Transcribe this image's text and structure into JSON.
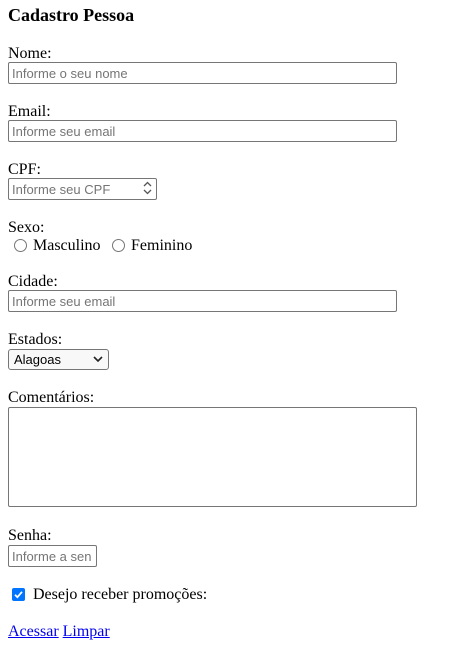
{
  "title": "Cadastro Pessoa",
  "fields": {
    "nome": {
      "label": "Nome:",
      "placeholder": "Informe o seu nome"
    },
    "email": {
      "label": "Email:",
      "placeholder": "Informe seu email"
    },
    "cpf": {
      "label": "CPF:",
      "placeholder": "Informe seu CPF"
    },
    "sexo": {
      "label": "Sexo:",
      "options": [
        "Masculino",
        "Feminino"
      ]
    },
    "cidade": {
      "label": "Cidade:",
      "placeholder": "Informe seu email"
    },
    "estados": {
      "label": "Estados:",
      "selected": "Alagoas"
    },
    "comentarios": {
      "label": "Comentários:"
    },
    "senha": {
      "label": "Senha:",
      "placeholder": "Informe a sen"
    },
    "promocoes": {
      "label": "Desejo receber promoções:",
      "checked": true
    }
  },
  "links": {
    "acessar": "Acessar",
    "limpar": "Limpar"
  },
  "colors": {
    "checkbox_accent": "#0075ff",
    "link": "#0000ee",
    "border": "#767676"
  }
}
